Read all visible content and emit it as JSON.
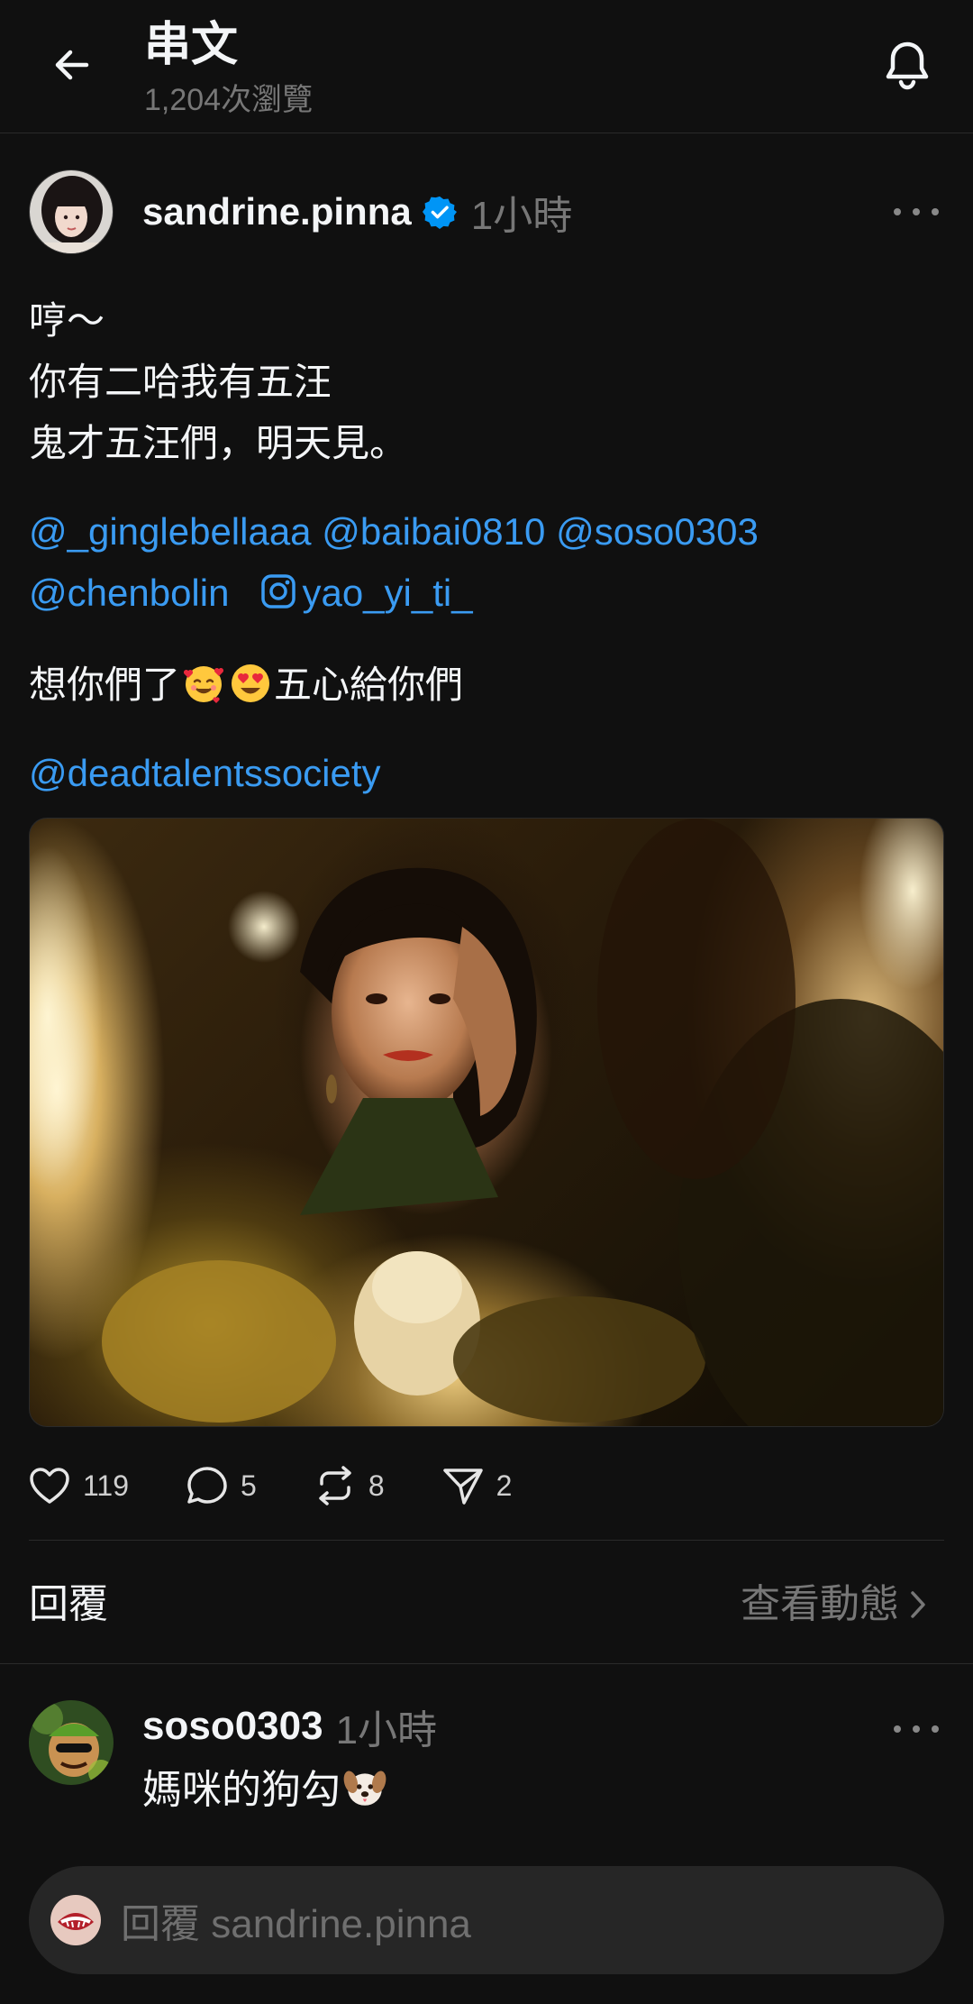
{
  "header": {
    "title": "串文",
    "views": "1,204次瀏覽"
  },
  "post": {
    "author": "sandrine.pinna",
    "time": "1小時",
    "lines": [
      "哼～",
      "你有二哈我有五汪",
      "鬼才五汪們，明天見。"
    ],
    "mentions_line1": [
      "@_ginglebellaaa",
      "@baibai0810",
      "@soso0303"
    ],
    "mention_chenbolin": "@chenbolin",
    "mention_instagram": "yao_yi_ti_",
    "line_after_mentions_start": "想你們了",
    "line_after_mentions_end": "五心給你們",
    "tag_account": "@deadtalentssociety",
    "actions": {
      "likes": "119",
      "comments": "5",
      "reposts": "8",
      "shares": "2"
    }
  },
  "replies_section": {
    "title": "回覆",
    "activity_link": "查看動態"
  },
  "reply": {
    "author": "soso0303",
    "time": "1小時",
    "text": "媽咪的狗勾"
  },
  "composer": {
    "placeholder": "回覆 sandrine.pinna"
  },
  "colors": {
    "background": "#101010",
    "link": "#3a9bf2",
    "verified": "#0095f6",
    "muted": "#777777"
  }
}
